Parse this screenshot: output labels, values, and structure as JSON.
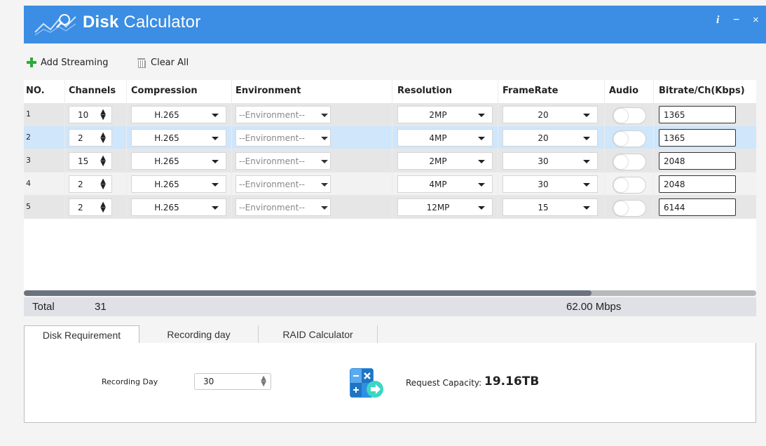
{
  "app": {
    "title_bold": "Disk",
    "title_rest": " Calculator"
  },
  "window_controls": {
    "info": "i",
    "minimize": "−",
    "close": "×"
  },
  "toolbar": {
    "add_label": "Add Streaming",
    "clear_label": "Clear All"
  },
  "table": {
    "headers": [
      "NO.",
      "Channels",
      "Compression",
      "Environment",
      "Resolution",
      "FrameRate",
      "Audio",
      "Bitrate/Ch(Kbps)"
    ],
    "rows": [
      {
        "no": "1",
        "channels": "10",
        "compression": "H.265",
        "environment": "--Environment--",
        "resolution": "2MP",
        "framerate": "20",
        "audio": false,
        "bitrate": "1365"
      },
      {
        "no": "2",
        "channels": "2",
        "compression": "H.265",
        "environment": "--Environment--",
        "resolution": "4MP",
        "framerate": "20",
        "audio": false,
        "bitrate": "1365"
      },
      {
        "no": "3",
        "channels": "15",
        "compression": "H.265",
        "environment": "--Environment--",
        "resolution": "2MP",
        "framerate": "30",
        "audio": false,
        "bitrate": "2048"
      },
      {
        "no": "4",
        "channels": "2",
        "compression": "H.265",
        "environment": "--Environment--",
        "resolution": "4MP",
        "framerate": "30",
        "audio": false,
        "bitrate": "2048"
      },
      {
        "no": "5",
        "channels": "2",
        "compression": "H.265",
        "environment": "--Environment--",
        "resolution": "12MP",
        "framerate": "15",
        "audio": false,
        "bitrate": "6144"
      }
    ],
    "selected_row": 2
  },
  "scrollbar": {
    "thumb_fraction": 0.775
  },
  "totals": {
    "label": "Total",
    "channels": "31",
    "bitrate": "62.00 Mbps"
  },
  "tabs": [
    {
      "label": "Disk Requirement",
      "active": true
    },
    {
      "label": "Recording day",
      "active": false
    },
    {
      "label": "RAID Calculator",
      "active": false
    }
  ],
  "disk_requirement": {
    "recording_day_label": "Recording Day",
    "recording_day_value": "30",
    "capacity_label": "Request Capacity:",
    "capacity_value": "19.16TB"
  },
  "colors": {
    "titlebar": "#3b8ee3",
    "add_icon": "#2eaa38",
    "selected_row": "#cfe6fb",
    "total_bar": "#dfe1e6"
  },
  "icons": [
    "chart-logo-icon",
    "info-icon",
    "minimize-icon",
    "close-icon",
    "plus-icon",
    "trash-icon",
    "spin-arrows-icon",
    "dropdown-caret-icon",
    "calculator-icon"
  ]
}
